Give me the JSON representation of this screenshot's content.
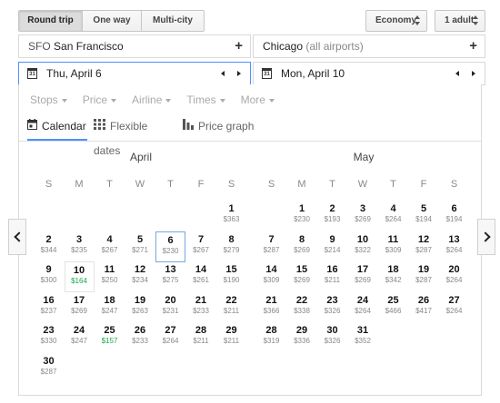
{
  "trip_types": [
    {
      "label": "Round trip",
      "active": true
    },
    {
      "label": "One way",
      "active": false
    },
    {
      "label": "Multi-city",
      "active": false
    }
  ],
  "cabin_class": "Economy",
  "passengers": "1 adult",
  "origin": {
    "code": "SFO",
    "city": "San Francisco"
  },
  "destination": {
    "city": "Chicago",
    "suffix": "(all airports)"
  },
  "depart_date": "Thu, April 6",
  "return_date": "Mon, April 10",
  "calendar_icon_text": "31",
  "filters": [
    "Stops",
    "Price",
    "Airline",
    "Times",
    "More"
  ],
  "tabs": [
    {
      "label": "Calendar",
      "icon": "calendar-icon",
      "active": true
    },
    {
      "label": "Flexible dates",
      "icon": "grid-icon",
      "active": false
    },
    {
      "label": "Price graph",
      "icon": "bar-graph-icon",
      "active": false
    }
  ],
  "weekdays": [
    "S",
    "M",
    "T",
    "W",
    "T",
    "F",
    "S"
  ],
  "colors": {
    "accent": "#4d90fe",
    "low_price": "#14a846"
  },
  "months": [
    {
      "name": "April",
      "first_weekday": 6,
      "days": [
        {
          "day": "1",
          "price": "$363"
        },
        {
          "day": "2",
          "price": "$344"
        },
        {
          "day": "3",
          "price": "$235"
        },
        {
          "day": "4",
          "price": "$267"
        },
        {
          "day": "5",
          "price": "$271"
        },
        {
          "day": "6",
          "price": "$230",
          "state": "selected"
        },
        {
          "day": "7",
          "price": "$267"
        },
        {
          "day": "8",
          "price": "$279"
        },
        {
          "day": "9",
          "price": "$300"
        },
        {
          "day": "10",
          "price": "$164",
          "low": true,
          "state": "return"
        },
        {
          "day": "11",
          "price": "$250"
        },
        {
          "day": "12",
          "price": "$234"
        },
        {
          "day": "13",
          "price": "$275"
        },
        {
          "day": "14",
          "price": "$261"
        },
        {
          "day": "15",
          "price": "$190"
        },
        {
          "day": "16",
          "price": "$237"
        },
        {
          "day": "17",
          "price": "$269"
        },
        {
          "day": "18",
          "price": "$247"
        },
        {
          "day": "19",
          "price": "$263"
        },
        {
          "day": "20",
          "price": "$231"
        },
        {
          "day": "21",
          "price": "$233"
        },
        {
          "day": "22",
          "price": "$211"
        },
        {
          "day": "23",
          "price": "$330"
        },
        {
          "day": "24",
          "price": "$247"
        },
        {
          "day": "25",
          "price": "$157",
          "low": true
        },
        {
          "day": "26",
          "price": "$233"
        },
        {
          "day": "27",
          "price": "$264"
        },
        {
          "day": "28",
          "price": "$211"
        },
        {
          "day": "29",
          "price": "$211"
        },
        {
          "day": "30",
          "price": "$287"
        }
      ]
    },
    {
      "name": "May",
      "first_weekday": 1,
      "days": [
        {
          "day": "1",
          "price": "$230"
        },
        {
          "day": "2",
          "price": "$193"
        },
        {
          "day": "3",
          "price": "$269"
        },
        {
          "day": "4",
          "price": "$264"
        },
        {
          "day": "5",
          "price": "$194"
        },
        {
          "day": "6",
          "price": "$194"
        },
        {
          "day": "7",
          "price": "$287"
        },
        {
          "day": "8",
          "price": "$269"
        },
        {
          "day": "9",
          "price": "$214"
        },
        {
          "day": "10",
          "price": "$322"
        },
        {
          "day": "11",
          "price": "$309"
        },
        {
          "day": "12",
          "price": "$287"
        },
        {
          "day": "13",
          "price": "$264"
        },
        {
          "day": "14",
          "price": "$309"
        },
        {
          "day": "15",
          "price": "$269"
        },
        {
          "day": "16",
          "price": "$211"
        },
        {
          "day": "17",
          "price": "$269"
        },
        {
          "day": "18",
          "price": "$342"
        },
        {
          "day": "19",
          "price": "$287"
        },
        {
          "day": "20",
          "price": "$264"
        },
        {
          "day": "21",
          "price": "$366"
        },
        {
          "day": "22",
          "price": "$338"
        },
        {
          "day": "23",
          "price": "$326"
        },
        {
          "day": "24",
          "price": "$264"
        },
        {
          "day": "25",
          "price": "$466"
        },
        {
          "day": "26",
          "price": "$417"
        },
        {
          "day": "27",
          "price": "$264"
        },
        {
          "day": "28",
          "price": "$319"
        },
        {
          "day": "29",
          "price": "$336"
        },
        {
          "day": "30",
          "price": "$326"
        },
        {
          "day": "31",
          "price": "$352"
        }
      ]
    }
  ]
}
